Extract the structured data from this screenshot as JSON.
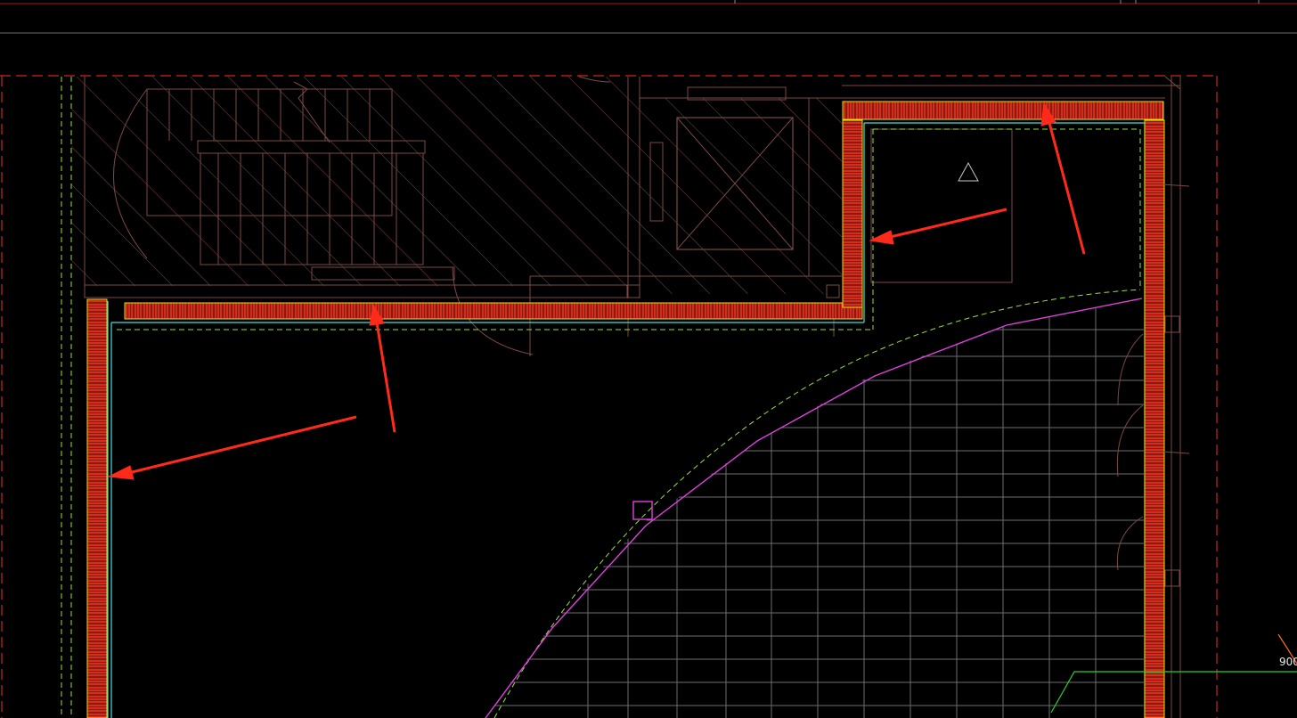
{
  "drawing": {
    "dimension_label": "900",
    "colors": {
      "background": "#000000",
      "hatch": "#7a4a46",
      "wall_red": "#c8281e",
      "insulation_yellow": "#e8e000",
      "cyan": "#40e0e0",
      "green_dashed": "#9ae03a",
      "magenta": "#e040e0",
      "grid_gray": "#6e6e6e",
      "arrow_red": "#ff2a1a",
      "dim_green": "#28d028",
      "frame_red": "#b01818",
      "frame_gray": "#8a8a8a"
    }
  }
}
